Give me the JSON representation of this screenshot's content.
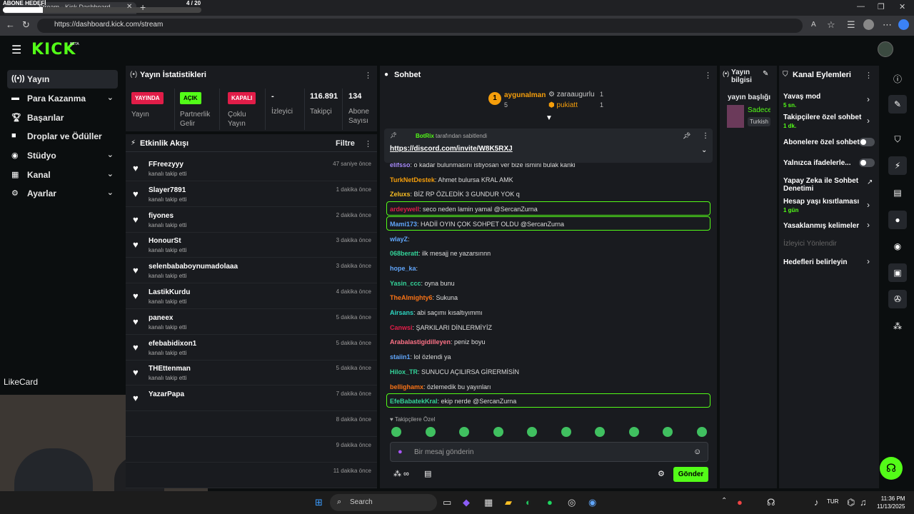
{
  "browser": {
    "tab_title": "Stream - Kick Dashboard",
    "url": "https://dashboard.kick.com/stream",
    "overlay_title": "ABONE HEDEFİ",
    "overlay_count": "4 / 20",
    "overlay_progress": 0.2
  },
  "header": {
    "logo": "KICK",
    "beta": "BETA"
  },
  "sidebar": {
    "items": [
      {
        "label": "Yayın",
        "icon": "broadcast-icon"
      },
      {
        "label": "Para Kazanma",
        "icon": "money-icon"
      },
      {
        "label": "Başarılar",
        "icon": "trophy-icon"
      },
      {
        "label": "Droplar ve Ödüller",
        "icon": "gift-icon"
      },
      {
        "label": "Stüdyo",
        "icon": "studio-icon"
      },
      {
        "label": "Kanal",
        "icon": "channel-icon"
      },
      {
        "label": "Ayarlar",
        "icon": "gear-icon"
      }
    ],
    "likecard": "LikeCard"
  },
  "stats": {
    "title": "Yayın İstatistikleri",
    "live_badge": "YAYINDA",
    "live_label": "Yayın",
    "partner_badge": "AÇIK",
    "partner_label_1": "Partnerlik",
    "partner_label_2": "Gelir",
    "multi_badge": "KAPALI",
    "multi_label_1": "Çoklu",
    "multi_label_2": "Yayın",
    "viewers_value": "-",
    "viewers_label": "İzleyici",
    "followers_value": "116.891",
    "followers_label": "Takipçi",
    "subs_value": "134",
    "subs_label_1": "Abone",
    "subs_label_2": "Sayısı"
  },
  "activity": {
    "title": "Etkinlik Akışı",
    "filter": "Filtre",
    "rows": [
      {
        "name": "FFreezyyy",
        "sub": "kanalı takip etti",
        "time": "47 saniye önce"
      },
      {
        "name": "Slayer7891",
        "sub": "kanalı takip etti",
        "time": "1 dakika önce"
      },
      {
        "name": "fiyones",
        "sub": "kanalı takip etti",
        "time": "2 dakika önce"
      },
      {
        "name": "HonourSt",
        "sub": "kanalı takip etti",
        "time": "3 dakika önce"
      },
      {
        "name": "selenbababoynumadolaaa",
        "sub": "kanalı takip etti",
        "time": "3 dakika önce"
      },
      {
        "name": "LastikKurdu",
        "sub": "kanalı takip etti",
        "time": "4 dakika önce"
      },
      {
        "name": "paneex",
        "sub": "kanalı takip etti",
        "time": "5 dakika önce"
      },
      {
        "name": "efebabidixon1",
        "sub": "kanalı takip etti",
        "time": "5 dakika önce"
      },
      {
        "name": "THEttenman",
        "sub": "kanalı takip etti",
        "time": "5 dakika önce"
      },
      {
        "name": "YazarPapa",
        "sub": "",
        "time": "7 dakika önce"
      },
      {
        "name": "",
        "sub": "",
        "time": "8 dakika önce"
      },
      {
        "name": "",
        "sub": "",
        "time": "9 dakika önce"
      },
      {
        "name": "",
        "sub": "",
        "time": "11 dakika önce"
      }
    ]
  },
  "chat": {
    "title": "Sohbet",
    "top_gifter_1": "aygunalman",
    "top_gifter_1_count": "5",
    "top_gifter_2": "zaraaugurlu",
    "top_gifter_2_count": "1",
    "top_gifter_3": "pukiatt",
    "top_gifter_3_count": "1",
    "pinned_by": "BotRix",
    "pinned_suffix": "tarafından sabitlendi",
    "pinned_link": "https://discord.com/invite/W8K5RXJ",
    "messages": [
      {
        "user": "elifsso",
        "color": "#a78bfa",
        "text": ": o kadar bulunmasını istiyosan ver bize ismini bulak kanki"
      },
      {
        "user": "TurkNetDestek",
        "color": "#f59e0b",
        "text": ": Ahmet bulursa KRAL AMK"
      },
      {
        "user": "Zeluxs",
        "color": "#fbbf24",
        "text": ": BİZ RP ÖZLEDİK 3 GUNDUR YOK q"
      },
      {
        "user": "ardeywell",
        "color": "#e11d48",
        "text": ": seco neden lamin yamal @SercanZurna"
      },
      {
        "user": "Mami173",
        "color": "#60a5fa",
        "text": ": HADİİ OYIN ÇOK SOHPET OLDU @SercanZurna"
      },
      {
        "user": "wlayZ",
        "color": "#60a5fa",
        "text": ":"
      },
      {
        "user": "068beratt",
        "color": "#34d399",
        "text": ": ilk mesajj ne yazarsınnn"
      },
      {
        "user": "hope_ka",
        "color": "#60a5fa",
        "text": ":"
      },
      {
        "user": "Yasin_ccc",
        "color": "#34d399",
        "text": ": oyna bunu"
      },
      {
        "user": "TheAlmighty6",
        "color": "#f97316",
        "text": ": Sukuna"
      },
      {
        "user": "Airsans",
        "color": "#2dd4bf",
        "text": ": abi saçımı kısaltıyımmı"
      },
      {
        "user": "Canwsi",
        "color": "#e11d48",
        "text": ": ŞARKILARI DİNLERMİYİZ"
      },
      {
        "user": "Arabalastigidilleyen",
        "color": "#fb7185",
        "text": ": peniz boyu"
      },
      {
        "user": "staiin1",
        "color": "#60a5fa",
        "text": ": lol özlendi ya"
      },
      {
        "user": "Hilox_TR",
        "color": "#34d399",
        "text": ": SUNUCU AÇILIRSA GİRERMİSİN"
      },
      {
        "user": "bellighamx",
        "color": "#f97316",
        "text": ": özlemedik bu yayınları"
      },
      {
        "user": "EfeBabatekKral",
        "color": "#34d399",
        "text": ": ekip nerde @SercanZurna"
      }
    ],
    "emote_section": "Takipçilere Özel",
    "input_placeholder": "Bir mesaj gönderin",
    "send_label": "Gönder"
  },
  "info": {
    "title": "Yayın bilgisi",
    "stream_title_label": "yayın başlığı",
    "stream_title_value": "Sadece",
    "category_tag": "Turkish"
  },
  "actions": {
    "title": "Kanal Eylemleri",
    "slow_mode": "Yavaş mod",
    "slow_mode_value": "5 sn.",
    "followers_only": "Takipçilere özel sohbet",
    "followers_only_value": "1 dk.",
    "subs_only": "Abonelere özel sohbet",
    "emote_only": "Yalnızca ifadelerle...",
    "ai_moderation": "Yapay Zeka ile Sohbet Denetimi",
    "age_restriction": "Hesap yaşı kısıtlaması",
    "age_restriction_value": "1 gün",
    "banned_words": "Yasaklanmış kelimeler",
    "raid": "İzleyici Yönlendir",
    "goals": "Hedefleri belirleyin"
  },
  "taskbar": {
    "search": "Search",
    "lang": "TUR",
    "time": "11:36 PM",
    "date": "11/13/2025"
  },
  "colors": {
    "accent": "#53fc18",
    "panel": "#191b1f",
    "live": "#e11d48"
  }
}
